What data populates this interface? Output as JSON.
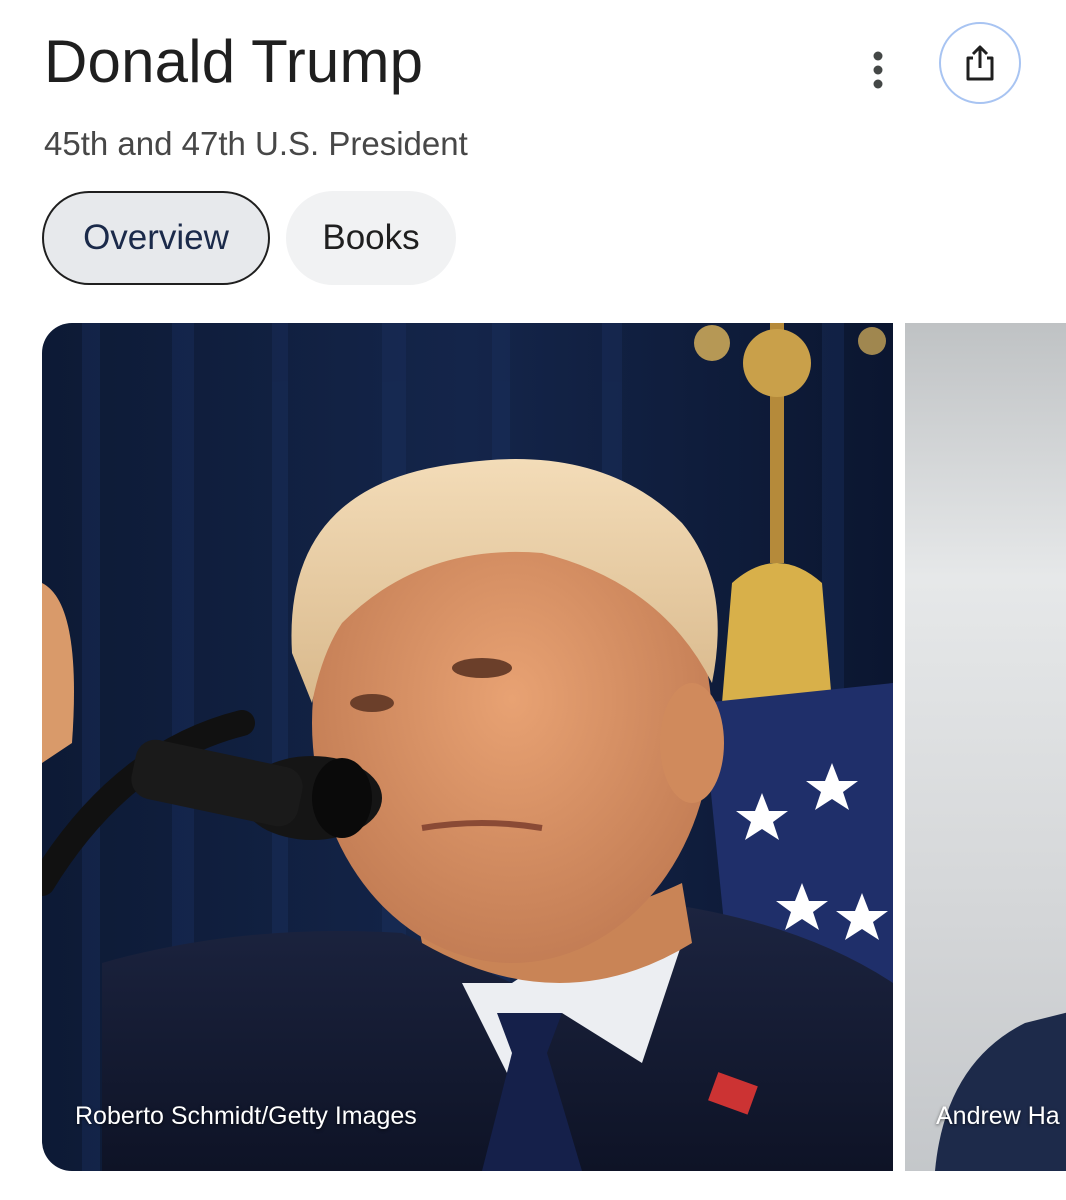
{
  "header": {
    "title": "Donald Trump",
    "subtitle": "45th and 47th U.S. President",
    "more_icon": "more-vert-icon",
    "share_icon": "share-icon",
    "share_border_color": "#a8c4f2"
  },
  "tabs": [
    {
      "label": "Overview",
      "selected": true
    },
    {
      "label": "Books",
      "selected": false
    }
  ],
  "images": [
    {
      "credit": "Roberto Schmidt/Getty Images"
    },
    {
      "credit": "Andrew Ha"
    }
  ]
}
